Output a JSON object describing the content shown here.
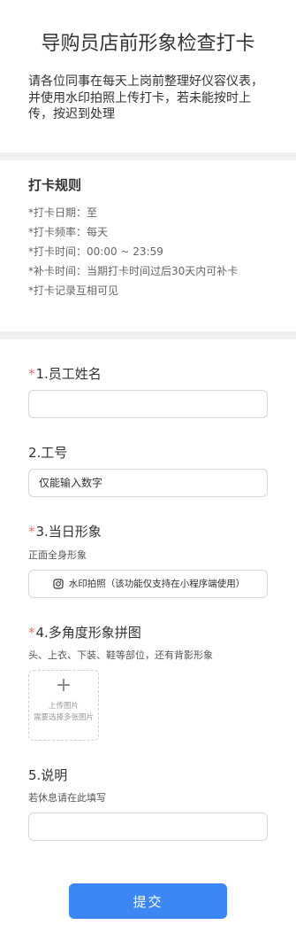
{
  "header": {
    "title": "导购员店前形象检查打卡",
    "description": "请各位同事在每天上岗前整理好仪容仪表，并使用水印拍照上传打卡，若未能按时上传，按迟到处理"
  },
  "rules": {
    "title": "打卡规则",
    "items": [
      "*打卡日期：至",
      "*打卡频率：每天",
      "*打卡时间：00:00 ~ 23:59",
      "*补卡时间：当期打卡时间过后30天内可补卡",
      "*打卡记录互相可见"
    ]
  },
  "questions": {
    "q1": {
      "required_mark": "*",
      "label": "1.员工姓名",
      "value": ""
    },
    "q2": {
      "label": "2.工号",
      "placeholder": "仅能输入数字"
    },
    "q3": {
      "required_mark": "*",
      "label": "3.当日形象",
      "subtitle": "正面全身形象",
      "button_label": "水印拍照（该功能仅支持在小程序端使用）",
      "button_icon": "camera-icon"
    },
    "q4": {
      "required_mark": "*",
      "label": "4.多角度形象拼图",
      "subtitle": "头、上衣、下装、鞋等部位，还有背影形象",
      "upload_icon": "plus-icon",
      "upload_line1": "上传图片",
      "upload_line2": "需要选择多张图片"
    },
    "q5": {
      "label": "5.说明",
      "subtitle": "若休息请在此填写",
      "value": ""
    }
  },
  "submit_label": "提交",
  "colors": {
    "accent": "#3d87f5",
    "required": "#f56c6c",
    "divider": "#f0f0f0"
  }
}
